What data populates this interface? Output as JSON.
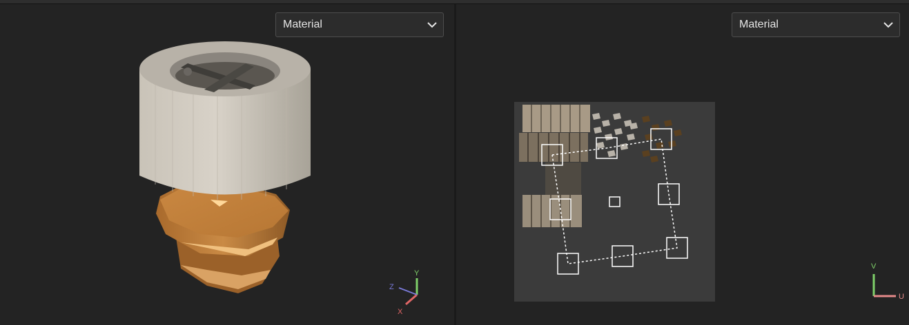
{
  "viewport_3d": {
    "mode_dropdown": {
      "selected": "Material"
    },
    "axis_gizmo": {
      "x": "X",
      "y": "Y",
      "z": "Z"
    }
  },
  "uv_editor": {
    "mode_dropdown": {
      "selected": "Material"
    },
    "axis_gizmo": {
      "u": "U",
      "v": "V"
    }
  },
  "colors": {
    "background": "#222222",
    "axis_x": "#e06666",
    "axis_y": "#7fd06a",
    "axis_z": "#7a7ad8",
    "axis_u": "#e58a8a",
    "axis_v": "#7fd06a"
  },
  "icons": [
    "chevron-down-icon",
    "axis-gizmo-xyz-icon",
    "axis-gizmo-uv-icon"
  ]
}
